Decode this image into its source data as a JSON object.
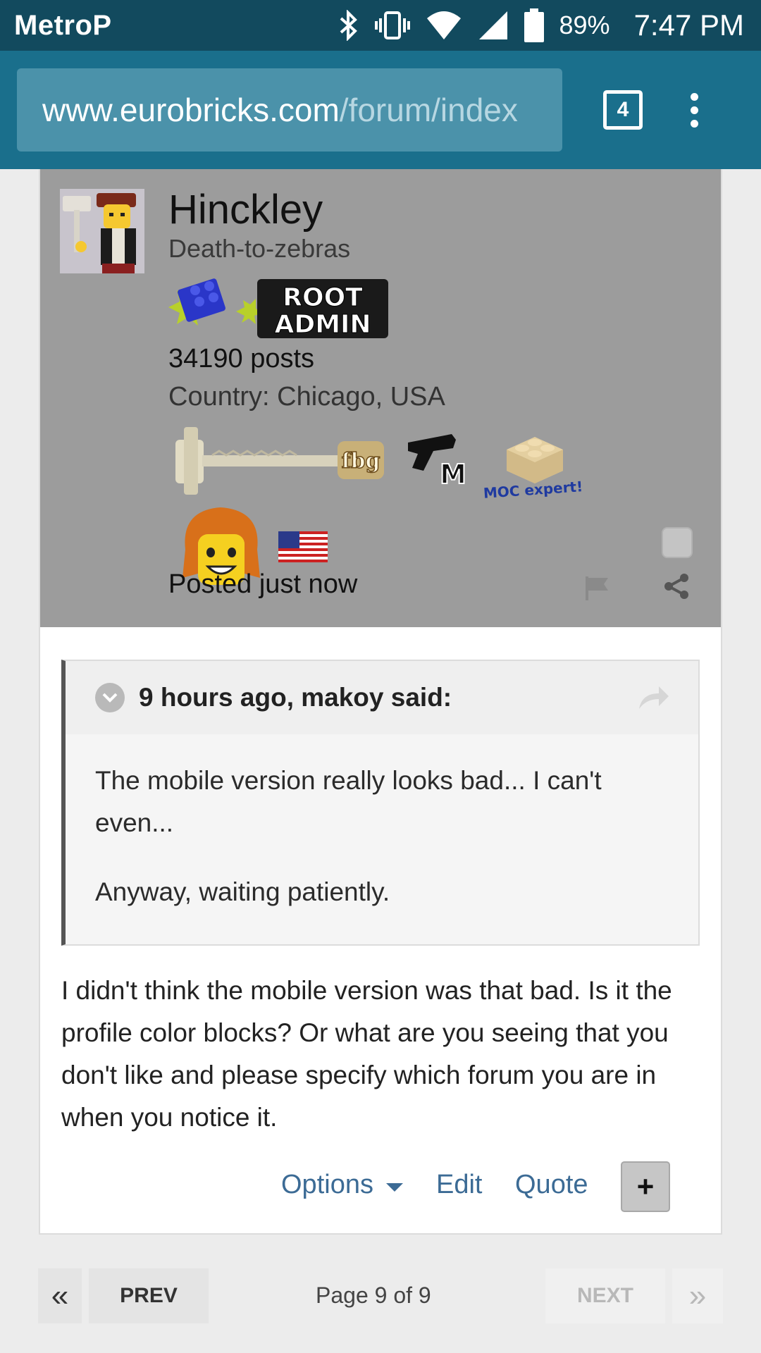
{
  "status_bar": {
    "carrier": "MetroP",
    "battery": "89%",
    "time": "7:47 PM",
    "icons": [
      "bluetooth-icon",
      "vibrate-icon",
      "wifi-icon",
      "signal-icon",
      "battery-icon"
    ]
  },
  "browser": {
    "url_host": "www.eurobricks.com",
    "url_path": "/forum/index",
    "tab_count": "4"
  },
  "post": {
    "author": {
      "name": "Hinckley",
      "title": "Death-to-zebras",
      "rank_badge_line1": "ROOT",
      "rank_badge_line2": "ADMIN",
      "post_count": "34190 posts",
      "country": "Country: Chicago, USA",
      "award_fbg": "fbg",
      "award_gun_letter": "M",
      "award_moc": "MOC expert!"
    },
    "posted": "Posted just now",
    "quote": {
      "citation": "9 hours ago, makoy said:",
      "paragraphs": [
        "The mobile version really looks bad... I can't even...",
        "Anyway, waiting patiently."
      ]
    },
    "body": "I didn't think the mobile version was that bad. Is it the profile color blocks? Or what are you seeing that you don't like and please specify which forum you are in when you notice it.",
    "actions": {
      "options": "Options",
      "edit": "Edit",
      "quote": "Quote",
      "multiquote": "+"
    }
  },
  "pagination": {
    "first": "«",
    "prev": "PREV",
    "label": "Page 9 of 9",
    "next": "NEXT",
    "last": "»"
  },
  "colors": {
    "status_bar": "#124a5e",
    "url_bar": "#1a6f8c",
    "author_panel": "#9c9c9c",
    "link": "#3c6b95"
  }
}
